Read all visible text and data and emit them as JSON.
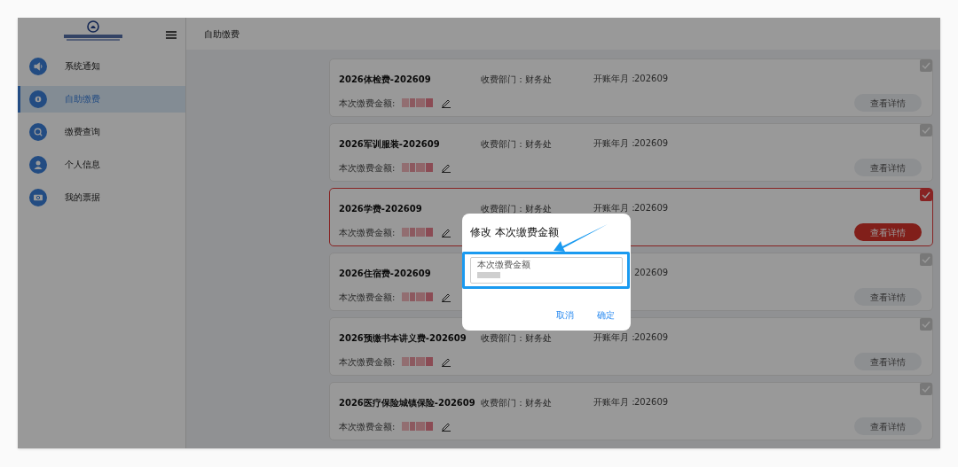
{
  "sidebar": {
    "items": [
      {
        "label": "系统通知",
        "selected": false
      },
      {
        "label": "自助缴费",
        "selected": true
      },
      {
        "label": "缴费查询",
        "selected": false
      },
      {
        "label": "个人信息",
        "selected": false
      },
      {
        "label": "我的票据",
        "selected": false
      }
    ]
  },
  "header": {
    "title": "自助缴费"
  },
  "bills": [
    {
      "title": "2026体检费-202609",
      "department": "收费部门：财务处",
      "period_label": "开账年月：",
      "period_value": "202609",
      "amount_label": "本次缴费金额:",
      "button": "查看详情",
      "selected": false
    },
    {
      "title": "2026军训服装-202609",
      "department": "收费部门：财务处",
      "period_label": "开账年月：",
      "period_value": "202609",
      "amount_label": "本次缴费金额:",
      "button": "查看详情",
      "selected": false
    },
    {
      "title": "2026学费-202609",
      "department": "收费部门：财务处",
      "period_label": "开账年月：",
      "period_value": "202609",
      "amount_label": "本次缴费金额:",
      "button": "查看详情",
      "selected": true
    },
    {
      "title": "2026住宿费-202609",
      "period_value": "202609",
      "amount_label": "本次缴费金额:",
      "button": "查看详情",
      "selected": false
    },
    {
      "title": "2026预缴书本讲义费-202609",
      "department": "收费部门：财务处",
      "period_label": "开账年月：",
      "period_value": "202609",
      "amount_label": "本次缴费金额:",
      "button": "查看详情",
      "selected": false
    },
    {
      "title": "2026医疗保险城镇保险-202609",
      "department": "收费部门：财务处",
      "period_label": "开账年月：",
      "period_value": "202609",
      "amount_label": "本次缴费金额:",
      "button": "查看详情",
      "selected": false
    }
  ],
  "dialog": {
    "title": "修改 本次缴费金额",
    "field_label": "本次缴费金额",
    "buttons": [
      "取消",
      "确定"
    ]
  }
}
